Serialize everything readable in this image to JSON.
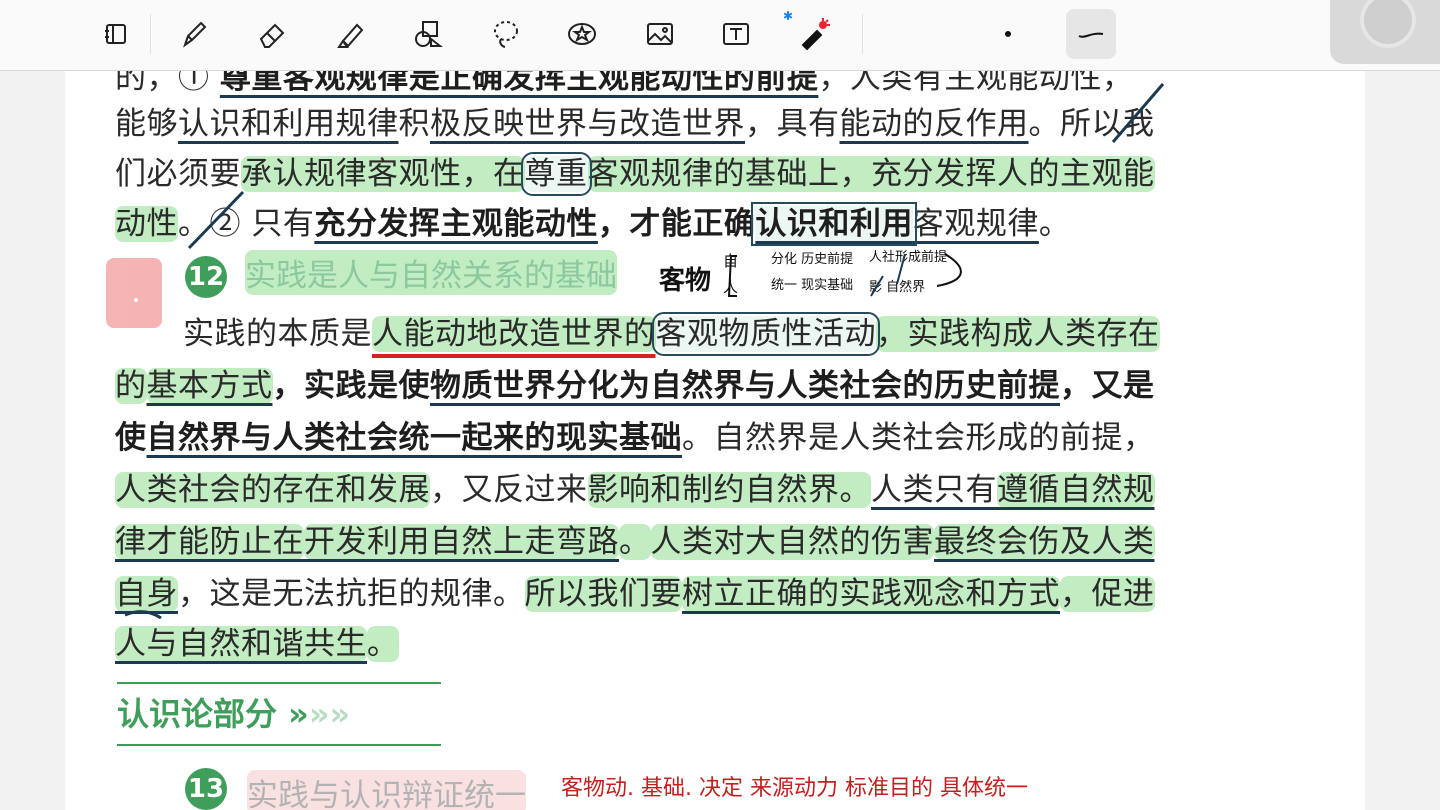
{
  "toolbar": {
    "tools": [
      {
        "name": "layout-icon"
      },
      {
        "name": "pen-icon"
      },
      {
        "name": "eraser-icon"
      },
      {
        "name": "highlighter-icon"
      },
      {
        "name": "shapes-icon"
      },
      {
        "name": "lasso-icon"
      },
      {
        "name": "sticker-icon"
      },
      {
        "name": "image-icon"
      },
      {
        "name": "textbox-icon"
      },
      {
        "name": "laser-pointer-icon"
      },
      {
        "name": "dot-size-icon"
      },
      {
        "name": "stroke-style-icon"
      }
    ],
    "bluetooth_icon": "bluetooth-icon"
  },
  "page": {
    "l1a": "的，① ",
    "l1b": "尊重客观规律是正确发挥主观能动性的前提",
    "l1c": "，人类有主观能动性，",
    "l2a": "能够",
    "l2b": "认识和利用规律",
    "l2c": "积",
    "l2d": "极反映世界与改造世界",
    "l2e": "，具有",
    "l2f": "能动的反作用",
    "l2g": "。所以我",
    "l3a": "们必须要",
    "l3b": "承认规律客观性，在",
    "l3c": "尊重",
    "l3d": "客观规律的基础上，充分发挥人的主观能",
    "l4a": "动性",
    "l4b": "。② 只有",
    "l4c": "充分发挥主观能动性",
    "l4d": "，才能正确",
    "l4e": "认识和利用",
    "l4f": "客观规律",
    "l4g": "。",
    "h12_num": "12",
    "h12_text": "实践是人与自然关系的基础",
    "l6a": "实践的本质是",
    "l6b": "人能动地改造世界的",
    "l6c": "客观物质性活动",
    "l6d": "，实践构成人类存在",
    "l7a": "的",
    "l7b": "基本方式",
    "l7c": "，实践是使",
    "l7d": "物质世界分化为自然界与人类社会的历史前提",
    "l7e": "，又是",
    "l8a": "使",
    "l8b": "自然界与人类社会统一起来的现实基础",
    "l8c": "。自然界是人类社会形成的前提，",
    "l9a": "人类社会的存在和发展",
    "l9b": "，又反过来",
    "l9c": "影响和制约自然界。",
    "l9d": "人类只有",
    "l9e": "遵循自然规",
    "l10a": "律才能防止在",
    "l10b": "开发利用自然上走弯路",
    "l10c": "。",
    "l10d": "人类对大自然的伤害",
    "l10e": "最终会伤及人类",
    "l11a": "自身",
    "l11b": "，这是无法抗拒的规律。",
    "l11c": "所以我们要",
    "l11d": "树立正确的实践观念和方式",
    "l11e": "，促进",
    "l12a": "人与自然和谐共生",
    "l12b": "。",
    "section_title": "认识论部分",
    "section_arrows": "»",
    "section_arrows_faded": "»»",
    "h13_num": "13",
    "h13_text": "实践与认识辩证统一"
  },
  "handwriting": {
    "n1": "客物",
    "n2a": "自",
    "n2b": "人",
    "n3": "分化 历史前提",
    "n4": "统一 现实基础",
    "n5": "人社形成前提",
    "n6": "影 自然界",
    "n7": "客物动. 基础. 决定 来源动力 标准目的 具体统一"
  },
  "colors": {
    "highlight": "#78d778",
    "ink_navy": "#1b3a52",
    "ink_red": "#d72020",
    "accent_green": "#3e9e5a"
  }
}
